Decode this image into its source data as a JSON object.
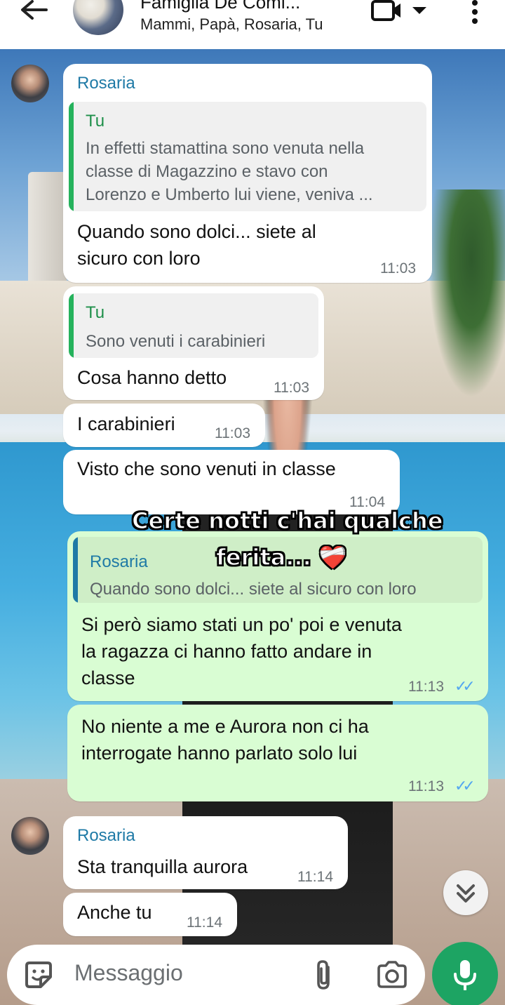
{
  "header": {
    "title": "Famiglia De Comi...",
    "subtitle": "Mammi, Papà, Rosaria, Tu"
  },
  "messages": {
    "m1": {
      "sender": "Rosaria",
      "quote_name": "Tu",
      "quote_lines": [
        "In effetti stamattina sono venuta nella",
        "classe di Magazzino e stavo con",
        "Lorenzo e Umberto lui viene, veniva ..."
      ],
      "text_lines": [
        "Quando sono dolci... siete al",
        "sicuro con loro"
      ],
      "time": "11:03"
    },
    "m2": {
      "quote_name": "Tu",
      "quote_text": "Sono venuti i carabinieri",
      "text": "Cosa hanno detto",
      "time": "11:03"
    },
    "m3": {
      "text": "I carabinieri",
      "time": "11:03"
    },
    "m4": {
      "text": "Visto che sono venuti in classe",
      "time": "11:04"
    },
    "m5": {
      "quote_name": "Rosaria",
      "quote_text": "Quando sono dolci... siete al sicuro con loro",
      "text_lines": [
        "Si però siamo stati un po' poi e venuta",
        "la ragazza ci hanno fatto andare in",
        "classe"
      ],
      "time": "11:13"
    },
    "m6": {
      "text_lines": [
        "No niente a me e Aurora non ci ha",
        "interrogate hanno parlato solo lui"
      ],
      "time": "11:13"
    },
    "m7": {
      "sender": "Rosaria",
      "text": "Sta tranquilla aurora",
      "time": "11:14"
    },
    "m8": {
      "text": "Anche tu",
      "time": "11:14"
    }
  },
  "overlay_caption": {
    "line1": "Certe notti c'hai qualche",
    "line2": "ferita... ❤️‍🩹"
  },
  "input": {
    "placeholder": "Messaggio"
  },
  "colors": {
    "sender_name": "#1f7aa6",
    "quote_you_bar": "#25b25c",
    "quote_rosaria_bar": "#1f7aa6",
    "outgoing_bubble": "#d9fdd3",
    "read_ticks": "#53a6f0",
    "mic_button": "#1da463"
  }
}
